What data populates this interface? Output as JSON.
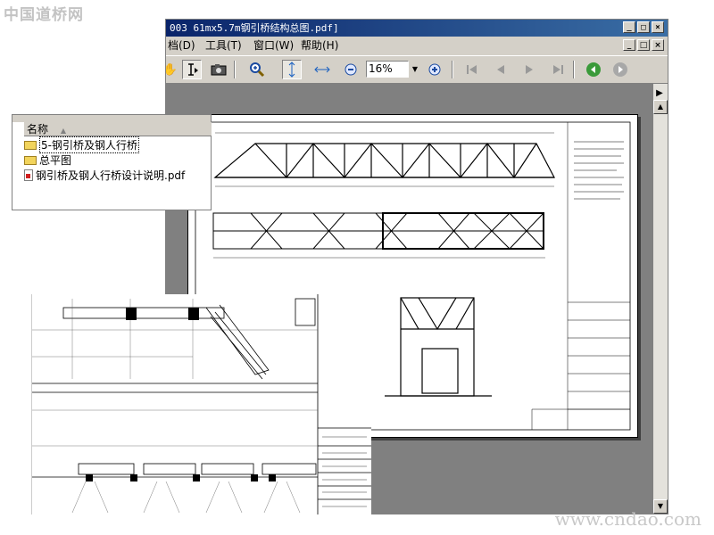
{
  "watermarks": {
    "top_left": "中国道桥网",
    "bottom_right": "www.cndao.com"
  },
  "window": {
    "title": "003 61mx5.7m钢引桥结构总图.pdf]",
    "buttons": {
      "minimize": "_",
      "maximize": "□",
      "close": "×"
    }
  },
  "menu": {
    "items": [
      "档(D)",
      "工具(T)",
      "窗口(W)",
      "帮助(H)"
    ]
  },
  "toolbar": {
    "zoom_value": "16%",
    "icons": [
      "hand-icon",
      "select-text-icon",
      "snapshot-icon",
      "zoom-in-icon",
      "fit-height-icon",
      "fit-width-icon",
      "zoom-out-icon",
      "zoom-plus-icon",
      "first-page-icon",
      "prev-page-icon",
      "next-page-icon",
      "last-page-icon",
      "back-icon",
      "forward-icon"
    ]
  },
  "explorer": {
    "column_header": "名称",
    "items": [
      {
        "type": "folder",
        "label": "5-钢引桥及钢人行桥"
      },
      {
        "type": "folder",
        "label": "总平图"
      },
      {
        "type": "pdf",
        "label": "钢引桥及钢人行桥设计说明.pdf"
      }
    ]
  },
  "colors": {
    "titlebar_start": "#0a246a",
    "titlebar_end": "#3a6ea5",
    "chrome": "#d4d0c8",
    "doc_bg": "#808080",
    "folder": "#f2d45c"
  }
}
